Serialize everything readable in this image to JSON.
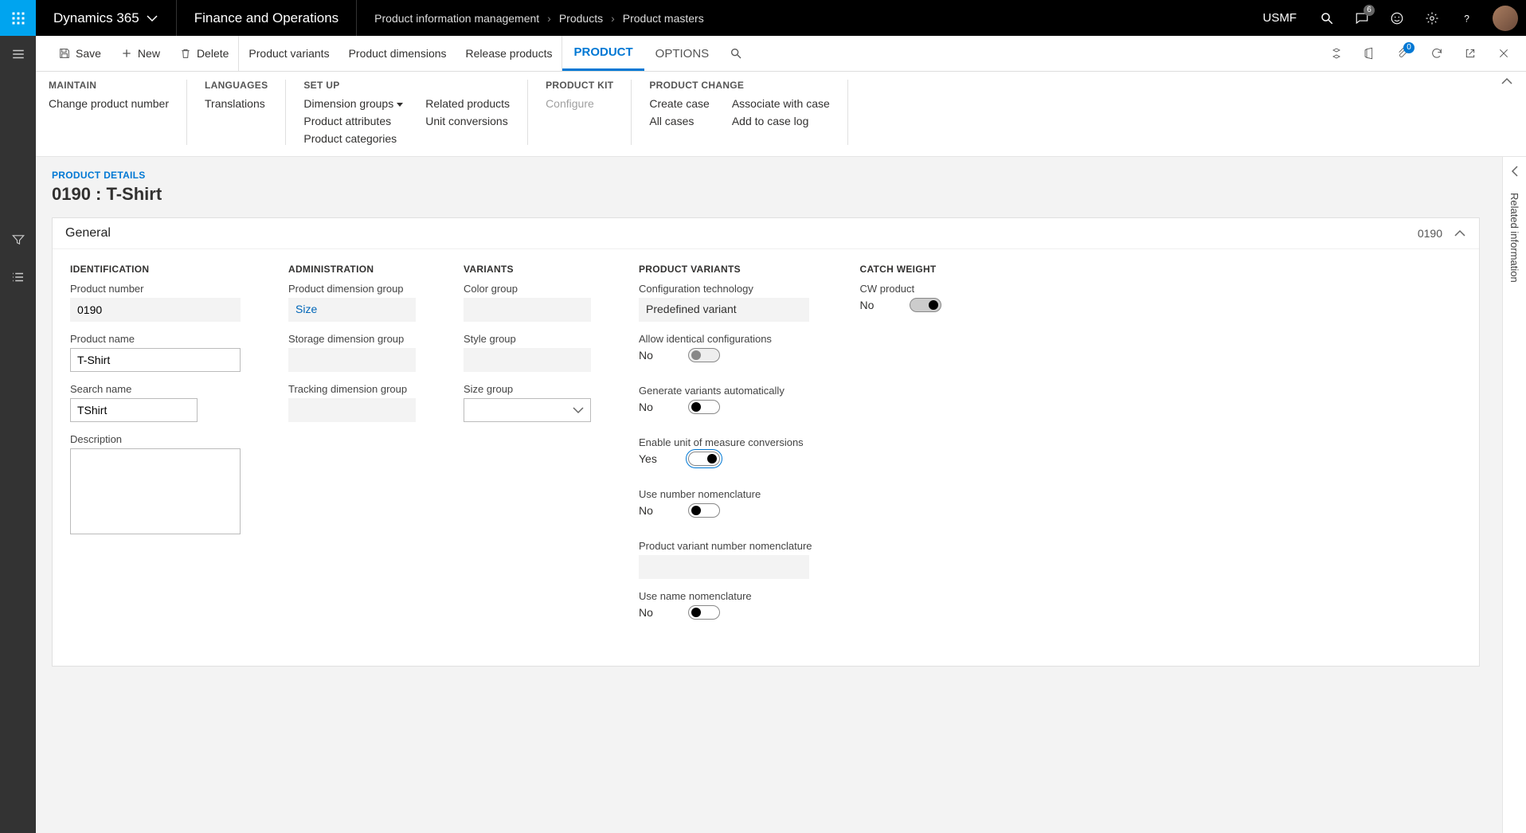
{
  "topbar": {
    "brand": "Dynamics 365",
    "module": "Finance and Operations",
    "breadcrumb": [
      "Product information management",
      "Products",
      "Product masters"
    ],
    "company": "USMF",
    "notif_count": "6"
  },
  "cmdbar": {
    "save": "Save",
    "new": "New",
    "delete": "Delete",
    "variants": "Product variants",
    "dimensions": "Product dimensions",
    "release": "Release products",
    "product_tab": "PRODUCT",
    "options_tab": "OPTIONS",
    "attach_count": "0"
  },
  "ribbon": {
    "maintain": {
      "title": "MAINTAIN",
      "links": [
        "Change product number"
      ]
    },
    "languages": {
      "title": "LANGUAGES",
      "links": [
        "Translations"
      ]
    },
    "setup": {
      "title": "SET UP",
      "col1": [
        "Dimension groups",
        "Product attributes",
        "Product categories"
      ],
      "col2": [
        "Related products",
        "Unit conversions"
      ]
    },
    "productkit": {
      "title": "PRODUCT KIT",
      "links": [
        "Configure"
      ]
    },
    "productchange": {
      "title": "PRODUCT CHANGE",
      "col1": [
        "Create case",
        "All cases"
      ],
      "col2": [
        "Associate with case",
        "Add to case log"
      ]
    }
  },
  "page": {
    "label": "PRODUCT DETAILS",
    "title": "0190 : T-Shirt"
  },
  "general": {
    "header": "General",
    "header_code": "0190",
    "identification": {
      "title": "IDENTIFICATION",
      "product_number_label": "Product number",
      "product_number": "0190",
      "product_name_label": "Product name",
      "product_name": "T-Shirt",
      "search_name_label": "Search name",
      "search_name": "TShirt",
      "description_label": "Description",
      "description": ""
    },
    "administration": {
      "title": "ADMINISTRATION",
      "pdg_label": "Product dimension group",
      "pdg": "Size",
      "sdg_label": "Storage dimension group",
      "sdg": "",
      "tdg_label": "Tracking dimension group",
      "tdg": ""
    },
    "variants": {
      "title": "VARIANTS",
      "color_label": "Color group",
      "color": "",
      "style_label": "Style group",
      "style": "",
      "size_label": "Size group",
      "size": ""
    },
    "product_variants": {
      "title": "PRODUCT VARIANTS",
      "config_tech_label": "Configuration technology",
      "config_tech": "Predefined variant",
      "allow_ident_label": "Allow identical configurations",
      "allow_ident": "No",
      "gen_auto_label": "Generate variants automatically",
      "gen_auto": "No",
      "enable_uom_label": "Enable unit of measure conversions",
      "enable_uom": "Yes",
      "use_numnom_label": "Use number nomenclature",
      "use_numnom": "No",
      "pvnn_label": "Product variant number nomenclature",
      "pvnn": "",
      "use_namenom_label": "Use name nomenclature",
      "use_namenom": "No"
    },
    "catch_weight": {
      "title": "CATCH WEIGHT",
      "cw_label": "CW product",
      "cw": "No"
    }
  },
  "rightrail": {
    "label": "Related information"
  }
}
